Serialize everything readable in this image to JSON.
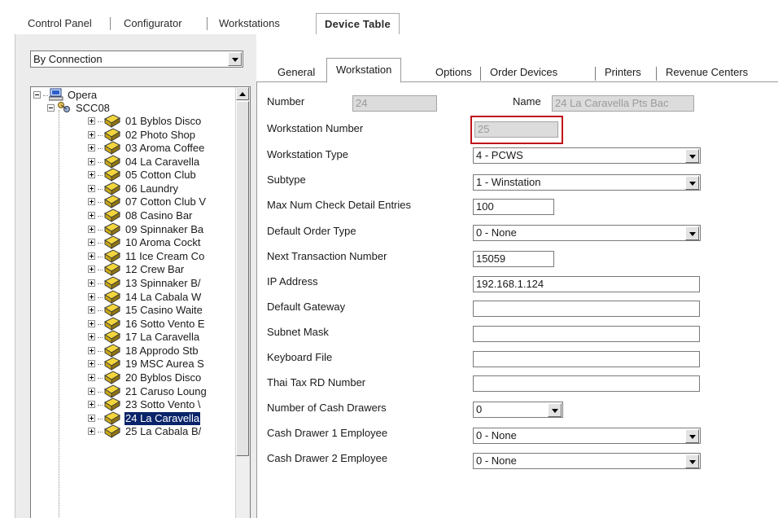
{
  "top_tabs": [
    {
      "label": "Control Panel",
      "active": false
    },
    {
      "label": "Configurator",
      "active": false
    },
    {
      "label": "Workstations",
      "active": false
    },
    {
      "label": "Device Table",
      "active": true
    }
  ],
  "left_pane": {
    "filter": {
      "selected": "By Connection"
    },
    "tree": {
      "root": {
        "label": "Opera",
        "icon": "computer-icon"
      },
      "server": {
        "label": "SCC08",
        "icon": "network-server-icon"
      },
      "items": [
        {
          "label": "01 Byblos Disco"
        },
        {
          "label": "02 Photo Shop"
        },
        {
          "label": "03 Aroma Coffee"
        },
        {
          "label": "04 La Caravella"
        },
        {
          "label": "05 Cotton Club"
        },
        {
          "label": "06 Laundry"
        },
        {
          "label": "07 Cotton Club V"
        },
        {
          "label": "08 Casino Bar"
        },
        {
          "label": "09 Spinnaker Ba"
        },
        {
          "label": "10 Aroma Cockt"
        },
        {
          "label": "11 Ice Cream Co"
        },
        {
          "label": "12 Crew Bar"
        },
        {
          "label": "13 Spinnaker B/"
        },
        {
          "label": "14 La Cabala W"
        },
        {
          "label": "15 Casino Waite"
        },
        {
          "label": "16 Sotto Vento E"
        },
        {
          "label": "17 La Caravella"
        },
        {
          "label": "18 Approdo Stb"
        },
        {
          "label": "19 MSC Aurea S"
        },
        {
          "label": "20 Byblos Disco"
        },
        {
          "label": "21 Caruso Loung"
        },
        {
          "label": "23 Sotto Vento \\"
        },
        {
          "label": "24 La Caravella"
        },
        {
          "label": "25 La Cabala B/"
        }
      ],
      "selected_index": 22
    }
  },
  "sub_tabs": [
    {
      "label": "General",
      "active": false
    },
    {
      "label": "Workstation",
      "active": true
    },
    {
      "label": "Options",
      "active": false
    },
    {
      "label": "Order Devices",
      "active": false
    },
    {
      "label": "Printers",
      "active": false
    },
    {
      "label": "Revenue Centers",
      "active": false
    }
  ],
  "form": {
    "number": {
      "label": "Number",
      "value": "24"
    },
    "name": {
      "label": "Name",
      "value": "24 La Caravella Pts Bac"
    },
    "workstation_number": {
      "label": "Workstation Number",
      "value": "25"
    },
    "workstation_type": {
      "label": "Workstation Type",
      "value": "4 - PCWS"
    },
    "subtype": {
      "label": "Subtype",
      "value": "1 - Winstation"
    },
    "max_check_detail": {
      "label": "Max Num Check Detail Entries",
      "value": "100"
    },
    "default_order_type": {
      "label": "Default Order Type",
      "value": "0 - None"
    },
    "next_transaction": {
      "label": "Next Transaction Number",
      "value": "15059"
    },
    "ip_address": {
      "label": "IP Address",
      "value": "192.168.1.124"
    },
    "default_gateway": {
      "label": "Default Gateway",
      "value": ""
    },
    "subnet_mask": {
      "label": "Subnet Mask",
      "value": ""
    },
    "keyboard_file": {
      "label": "Keyboard File",
      "value": ""
    },
    "thai_tax": {
      "label": "Thai Tax RD Number",
      "value": ""
    },
    "cash_drawers": {
      "label": "Number of Cash Drawers",
      "value": "0"
    },
    "cash_drawer1": {
      "label": "Cash Drawer 1 Employee",
      "value": "0 - None"
    },
    "cash_drawer2": {
      "label": "Cash Drawer 2 Employee",
      "value": "0 - None"
    }
  },
  "colors": {
    "selection": "#0a246a",
    "highlight_border": "#c0141a",
    "disabled_field": "#dcdcdc"
  }
}
